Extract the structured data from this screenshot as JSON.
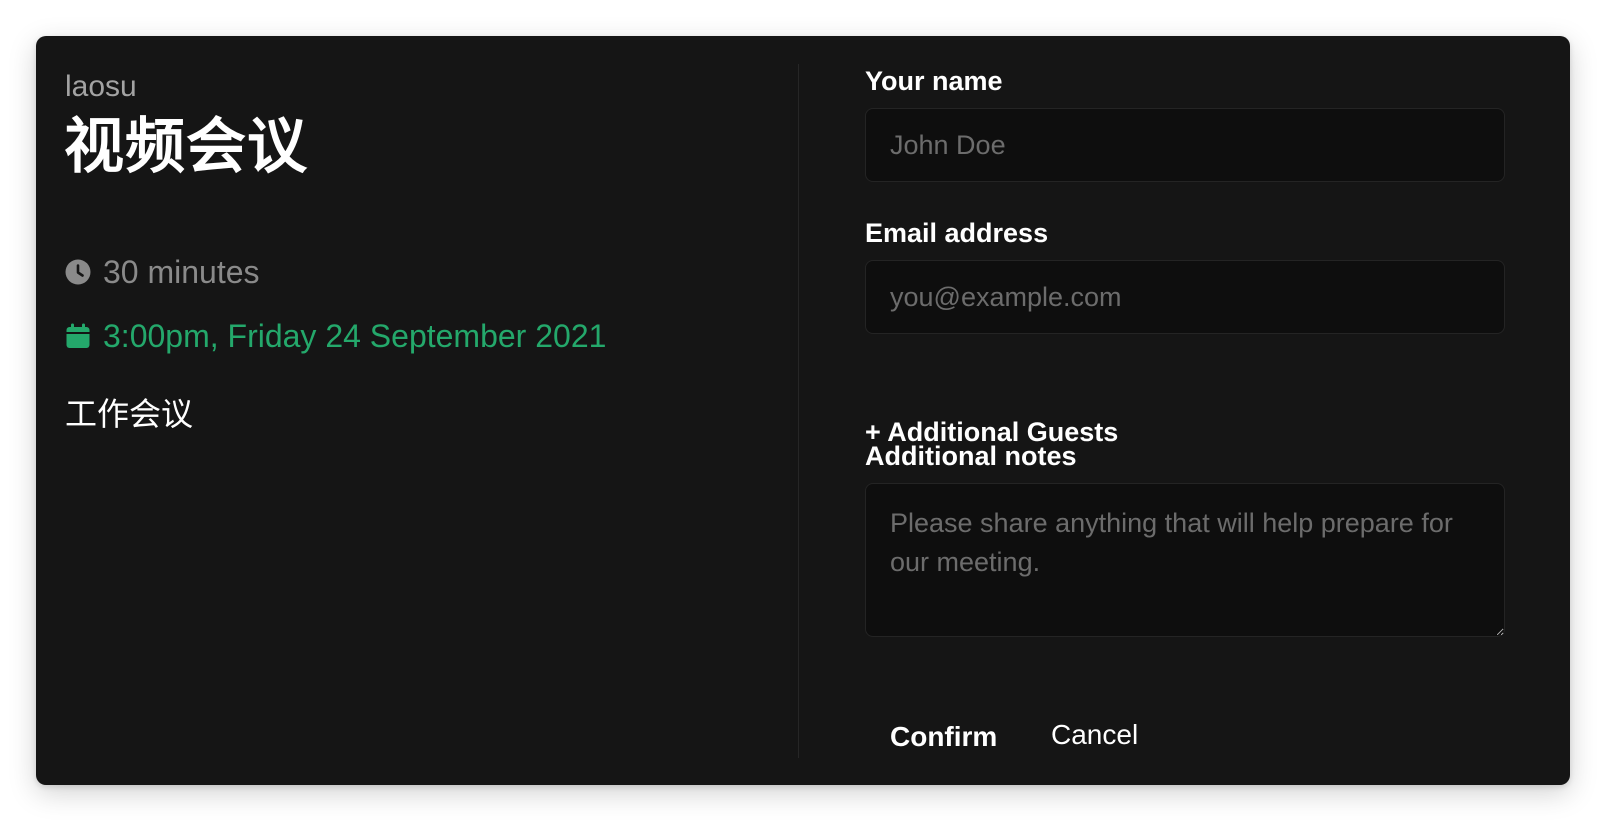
{
  "event": {
    "user": "laosu",
    "title": "视频会议",
    "duration": "30 minutes",
    "datetime": "3:00pm, Friday 24 September 2021",
    "description": "工作会议",
    "icons": {
      "duration": "clock-icon",
      "datetime": "calendar-icon"
    },
    "colors": {
      "accent": "#24a86b",
      "background": "#151515",
      "muted": "#8a8a8a"
    }
  },
  "form": {
    "name_label": "Your name",
    "name_placeholder": "John Doe",
    "email_label": "Email address",
    "email_placeholder": "you@example.com",
    "guests_label": "+ Additional Guests",
    "notes_label": "Additional notes",
    "notes_placeholder": "Please share anything that will help prepare for our meeting.",
    "confirm_label": "Confirm",
    "cancel_label": "Cancel"
  }
}
